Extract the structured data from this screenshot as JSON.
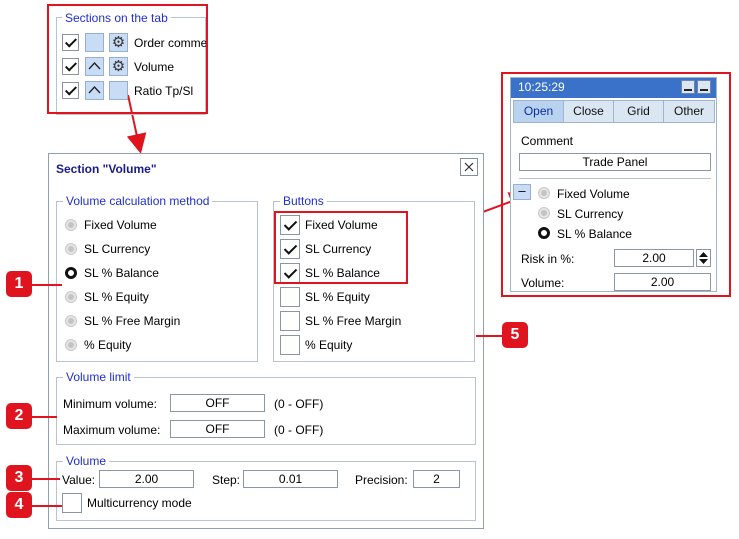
{
  "sections_panel": {
    "legend": "Sections on the tab",
    "rows": [
      {
        "label": "Order comme",
        "checked": true,
        "chart_icon": false,
        "settings_icon": true
      },
      {
        "label": "Volume",
        "checked": true,
        "chart_icon": true,
        "settings_icon": true
      },
      {
        "label": "Ratio Tp/Sl",
        "checked": true,
        "chart_icon": true,
        "settings_icon": false
      }
    ]
  },
  "dialog": {
    "title": "Section \"Volume\"",
    "volume_method": {
      "legend": "Volume calculation method",
      "options": [
        "Fixed Volume",
        "SL Currency",
        "SL % Balance",
        "SL % Equity",
        "SL % Free Margin",
        "% Equity"
      ],
      "selected_index": 2
    },
    "buttons": {
      "legend": "Buttons",
      "items": [
        {
          "label": "Fixed Volume",
          "checked": true
        },
        {
          "label": "SL Currency",
          "checked": true
        },
        {
          "label": "SL % Balance",
          "checked": true
        },
        {
          "label": "SL % Equity",
          "checked": false
        },
        {
          "label": "SL % Free Margin",
          "checked": false
        },
        {
          "label": "% Equity",
          "checked": false
        }
      ]
    },
    "volume_limit": {
      "legend": "Volume limit",
      "min_label": "Minimum volume:",
      "min_value": "OFF",
      "min_hint": "(0 - OFF)",
      "max_label": "Maximum volume:",
      "max_value": "OFF",
      "max_hint": "(0 - OFF)"
    },
    "volume": {
      "legend": "Volume",
      "value_label": "Value:",
      "value": "2.00",
      "step_label": "Step:",
      "step": "0.01",
      "precision_label": "Precision:",
      "precision": "2",
      "multicurrency_label": "Multicurrency mode",
      "multicurrency_checked": false
    }
  },
  "trade_panel": {
    "time": "10:25:29",
    "tabs": [
      "Open",
      "Close",
      "Grid",
      "Other"
    ],
    "active_tab": 0,
    "comment_label": "Comment",
    "comment_button": "Trade Panel",
    "collapse_glyph": "–",
    "radios": [
      "Fixed Volume",
      "SL Currency",
      "SL % Balance"
    ],
    "selected_radio": 2,
    "risk_label": "Risk in %:",
    "risk_value": "2.00",
    "volume_label": "Volume:",
    "volume_value": "2.00"
  },
  "annotations": [
    "1",
    "2",
    "3",
    "4",
    "5"
  ],
  "colors": {
    "accent_red": "#e0141e",
    "legend_blue": "#1f2fd0",
    "tab_blue": "#b9d2f0"
  }
}
